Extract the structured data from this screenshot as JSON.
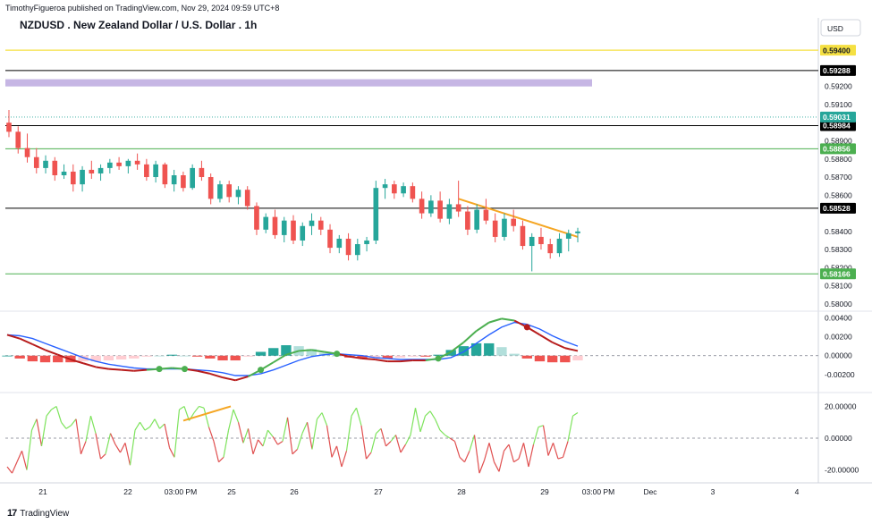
{
  "header": {
    "published": "TimothyFigueroa published on TradingView.com, Nov 29, 2024 09:59 UTC+8",
    "symbol_title": "NZDUSD . New Zealand Dollar / U.S. Dollar . 1h"
  },
  "currency_label": "USD",
  "brand": "TradingView",
  "colors": {
    "up": "#26a69a",
    "down": "#ef5350",
    "support_green": "#4caf50",
    "resistance_black": "#000000",
    "yellow_line": "#f5e042",
    "purple_zone": "#b39ddb",
    "trendline_orange": "#f5a623",
    "macd_green": "#4caf50",
    "macd_blue": "#2962ff",
    "macd_red": "#b71c1c",
    "rsi_green": "#7ee35d",
    "rsi_red": "#e05050"
  },
  "chart_data": [
    {
      "type": "candlestick",
      "title": "NZDUSD . New Zealand Dollar / U.S. Dollar . 1h",
      "timeframe": "1h",
      "x_ticks": [
        "21",
        "22",
        "03:00 PM",
        "25",
        "26",
        "27",
        "28",
        "29",
        "03:00 PM",
        "Dec",
        "3",
        "4"
      ],
      "y_ticks": [
        "0.59200",
        "0.59100",
        "0.58900",
        "0.58800",
        "0.58700",
        "0.58600",
        "0.58400",
        "0.58300",
        "0.58200",
        "0.58100",
        "0.58000"
      ],
      "ylim": [
        0.5797,
        0.5945
      ],
      "horizontal_levels": [
        {
          "label": "0.59400",
          "value": 0.594,
          "color": "#f5e042",
          "style": "yellow-line"
        },
        {
          "label": "0.59288",
          "value": 0.59288,
          "color": "#000000",
          "style": "black-badge"
        },
        {
          "label": "0.58984",
          "value": 0.58984,
          "color": "#000000",
          "style": "black-badge"
        },
        {
          "label": "0.58856",
          "value": 0.58856,
          "color": "#4caf50",
          "style": "green-badge"
        },
        {
          "label": "0.58528",
          "value": 0.58528,
          "color": "#000000",
          "style": "black-badge"
        },
        {
          "label": "0.58166",
          "value": 0.58166,
          "color": "#4caf50",
          "style": "green-badge"
        }
      ],
      "last_price": {
        "label": "0.59031",
        "value": 0.59031
      },
      "zone": {
        "from": 0.592,
        "to": 0.5924,
        "color": "#b39ddb"
      },
      "trendline": {
        "from_bar": 49,
        "from_price": 0.5858,
        "to_bar": 62,
        "to_price": 0.5837
      },
      "candles": [
        [
          0.59,
          0.5907,
          0.5892,
          0.5895
        ],
        [
          0.5895,
          0.5898,
          0.5883,
          0.5886
        ],
        [
          0.5886,
          0.5894,
          0.5878,
          0.5881
        ],
        [
          0.5881,
          0.5886,
          0.5872,
          0.5875
        ],
        [
          0.5875,
          0.5882,
          0.5872,
          0.5879
        ],
        [
          0.5879,
          0.5881,
          0.5868,
          0.5871
        ],
        [
          0.5871,
          0.5877,
          0.5869,
          0.5873
        ],
        [
          0.5873,
          0.5877,
          0.5862,
          0.5866
        ],
        [
          0.5866,
          0.5876,
          0.5862,
          0.5874
        ],
        [
          0.5874,
          0.5879,
          0.5869,
          0.5872
        ],
        [
          0.5872,
          0.5877,
          0.5868,
          0.5875
        ],
        [
          0.5875,
          0.588,
          0.5872,
          0.5878
        ],
        [
          0.5878,
          0.5881,
          0.5874,
          0.5876
        ],
        [
          0.5876,
          0.588,
          0.5872,
          0.5879
        ],
        [
          0.5879,
          0.5883,
          0.5874,
          0.5877
        ],
        [
          0.5877,
          0.588,
          0.5868,
          0.587
        ],
        [
          0.587,
          0.5879,
          0.5867,
          0.5877
        ],
        [
          0.5877,
          0.5878,
          0.5864,
          0.5866
        ],
        [
          0.5866,
          0.5874,
          0.5862,
          0.5871
        ],
        [
          0.5871,
          0.5873,
          0.5862,
          0.5864
        ],
        [
          0.5864,
          0.5877,
          0.5863,
          0.5875
        ],
        [
          0.5875,
          0.5879,
          0.5868,
          0.587
        ],
        [
          0.587,
          0.5872,
          0.5855,
          0.5858
        ],
        [
          0.5858,
          0.5868,
          0.5856,
          0.5866
        ],
        [
          0.5866,
          0.5868,
          0.5856,
          0.5859
        ],
        [
          0.5859,
          0.5865,
          0.5855,
          0.5863
        ],
        [
          0.5863,
          0.5865,
          0.5852,
          0.5854
        ],
        [
          0.5854,
          0.5856,
          0.5838,
          0.5841
        ],
        [
          0.5841,
          0.585,
          0.5839,
          0.5848
        ],
        [
          0.5848,
          0.5852,
          0.5836,
          0.5838
        ],
        [
          0.5838,
          0.5848,
          0.5834,
          0.5846
        ],
        [
          0.5846,
          0.5849,
          0.5833,
          0.5835
        ],
        [
          0.5835,
          0.5845,
          0.5832,
          0.5843
        ],
        [
          0.5843,
          0.585,
          0.5838,
          0.5846
        ],
        [
          0.5846,
          0.5848,
          0.5838,
          0.5841
        ],
        [
          0.5841,
          0.5844,
          0.5828,
          0.5831
        ],
        [
          0.5831,
          0.5838,
          0.5828,
          0.5836
        ],
        [
          0.5836,
          0.5839,
          0.5824,
          0.5827
        ],
        [
          0.5827,
          0.5836,
          0.5824,
          0.5833
        ],
        [
          0.5833,
          0.5837,
          0.5829,
          0.5835
        ],
        [
          0.5835,
          0.5868,
          0.5833,
          0.5864
        ],
        [
          0.5864,
          0.5869,
          0.5858,
          0.5866
        ],
        [
          0.5866,
          0.5868,
          0.5858,
          0.5861
        ],
        [
          0.5861,
          0.5867,
          0.5859,
          0.5865
        ],
        [
          0.5865,
          0.5867,
          0.5856,
          0.5858
        ],
        [
          0.5858,
          0.5862,
          0.5847,
          0.585
        ],
        [
          0.585,
          0.586,
          0.5848,
          0.5857
        ],
        [
          0.5857,
          0.5862,
          0.5845,
          0.5847
        ],
        [
          0.5847,
          0.5858,
          0.5844,
          0.5855
        ],
        [
          0.5855,
          0.5868,
          0.5848,
          0.5851
        ],
        [
          0.5851,
          0.5854,
          0.5838,
          0.5841
        ],
        [
          0.5841,
          0.5855,
          0.5839,
          0.5852
        ],
        [
          0.5852,
          0.5858,
          0.5844,
          0.5846
        ],
        [
          0.5846,
          0.585,
          0.5834,
          0.5837
        ],
        [
          0.5837,
          0.585,
          0.5835,
          0.5847
        ],
        [
          0.5847,
          0.5852,
          0.584,
          0.5843
        ],
        [
          0.5843,
          0.5846,
          0.583,
          0.5832
        ],
        [
          0.5832,
          0.5839,
          0.5818,
          0.5837
        ],
        [
          0.5837,
          0.5842,
          0.583,
          0.5833
        ],
        [
          0.5833,
          0.5836,
          0.5825,
          0.5828
        ],
        [
          0.5828,
          0.5839,
          0.5826,
          0.5836
        ],
        [
          0.5836,
          0.5841,
          0.5829,
          0.5839
        ],
        [
          0.5839,
          0.5842,
          0.5834,
          0.584
        ]
      ]
    },
    {
      "type": "line",
      "panel": "MACD",
      "y_ticks": [
        "0.00400",
        "0.00200",
        "0.00000",
        "-0.00200"
      ],
      "ylim": [
        -0.0037,
        0.0045
      ],
      "series": [
        {
          "name": "",
          "color": "#4caf50",
          "values": [
            0.0022,
            0.0018,
            0.0012,
            0.0006,
            0.0001,
            -0.0004,
            -0.0008,
            -0.0012,
            -0.0014,
            -0.0015,
            -0.0016,
            -0.0015,
            -0.0014,
            -0.0013,
            -0.0014,
            -0.0016,
            -0.0019,
            -0.0023,
            -0.0026,
            -0.0022,
            -0.0015,
            -0.0007,
            0.0001,
            0.0005,
            0.0006,
            0.0004,
            0.0002,
            -0.0001,
            -0.0003,
            -0.0004,
            -0.0006,
            -0.0006,
            -0.0005,
            -0.0005,
            -0.0003,
            0.0004,
            0.0014,
            0.0026,
            0.0035,
            0.0039,
            0.0037,
            0.003,
            0.0022,
            0.0014,
            0.0008,
            0.0005
          ]
        },
        {
          "name": "",
          "color": "#2962ff",
          "values": [
            0.0022,
            0.0021,
            0.0018,
            0.0013,
            0.0008,
            0.0003,
            -0.0002,
            -0.0006,
            -0.0009,
            -0.0011,
            -0.0013,
            -0.0014,
            -0.0014,
            -0.0014,
            -0.0014,
            -0.0015,
            -0.0016,
            -0.0018,
            -0.0021,
            -0.0021,
            -0.0019,
            -0.0015,
            -0.001,
            -0.0005,
            -0.0001,
            0.0001,
            0.0002,
            0.0001,
            0.0,
            -0.0002,
            -0.0003,
            -0.0004,
            -0.0004,
            -0.0004,
            -0.0004,
            -0.0002,
            0.0004,
            0.0013,
            0.0022,
            0.003,
            0.0035,
            0.0033,
            0.0028,
            0.0021,
            0.0015,
            0.001
          ]
        }
      ]
    },
    {
      "type": "line",
      "panel": "RSI",
      "y_ticks": [
        "20.00000",
        "0.00000",
        "-20.00000"
      ],
      "ylim": [
        -27,
        27
      ],
      "series": [
        {
          "name": "",
          "values": [
            -18,
            -22,
            -15,
            -8,
            -20,
            5,
            12,
            -5,
            14,
            18,
            20,
            10,
            6,
            8,
            12,
            -10,
            -2,
            14,
            3,
            -13,
            -10,
            3,
            -4,
            -9,
            -3,
            -17,
            5,
            10,
            5,
            7,
            12,
            6,
            9,
            -6,
            -12,
            18,
            20,
            11,
            16,
            20,
            19,
            7,
            -2,
            -15,
            -12,
            5,
            18,
            10,
            -3,
            6,
            -10,
            -1,
            -5,
            5,
            1,
            -4,
            -2,
            13,
            -10,
            -7,
            3,
            10,
            -7,
            12,
            16,
            8,
            -12,
            -5,
            -18,
            -8,
            14,
            19,
            8,
            -13,
            -9,
            3,
            6,
            -5,
            -2,
            2,
            -9,
            -4,
            2,
            19,
            4,
            14,
            17,
            12,
            5,
            2,
            0,
            -2,
            -12,
            -15,
            -8,
            2,
            -22,
            -14,
            -3,
            -15,
            -21,
            -8,
            -4,
            -15,
            -13,
            -3,
            -18,
            -4,
            7,
            8,
            -11,
            -3,
            -13,
            -12,
            -2,
            14,
            16
          ]
        }
      ]
    }
  ]
}
